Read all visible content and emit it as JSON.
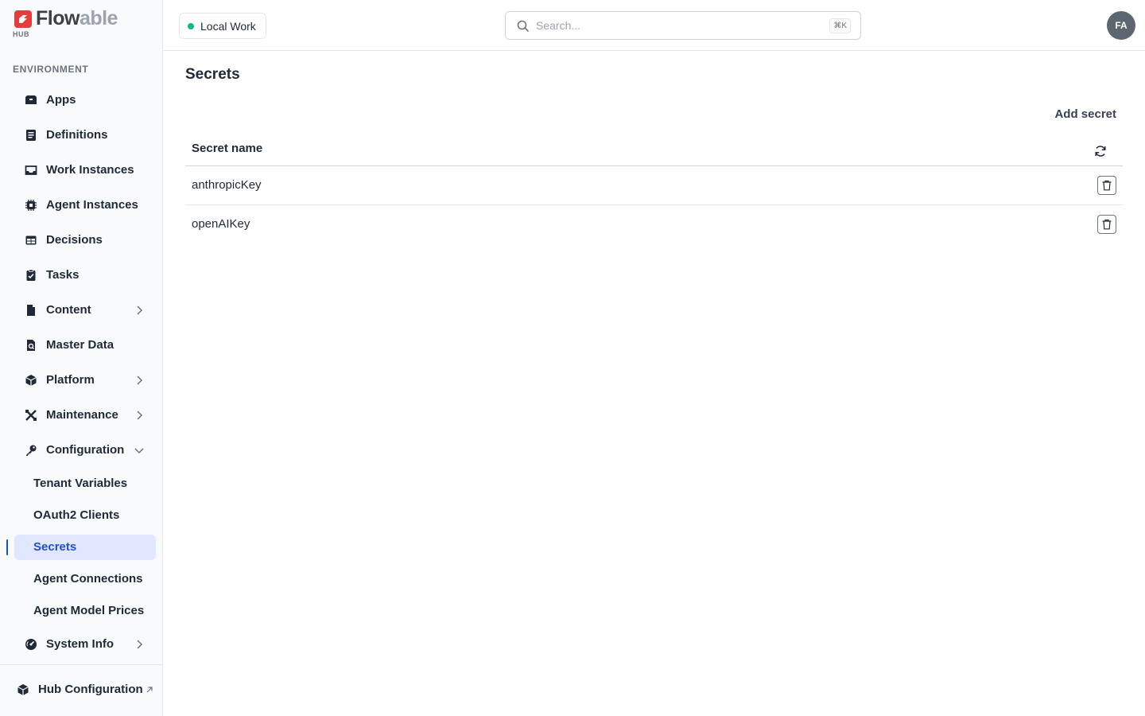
{
  "brand": {
    "name_main": "Flow",
    "name_accent": "able",
    "sub": "HUB",
    "color": "#e63c3c"
  },
  "sidebar": {
    "section_label": "ENVIRONMENT",
    "items": [
      {
        "label": "Apps",
        "icon": "apps-icon"
      },
      {
        "label": "Definitions",
        "icon": "definitions-icon"
      },
      {
        "label": "Work Instances",
        "icon": "inbox-icon"
      },
      {
        "label": "Agent Instances",
        "icon": "chip-icon"
      },
      {
        "label": "Decisions",
        "icon": "table-icon"
      },
      {
        "label": "Tasks",
        "icon": "clipboard-check-icon"
      },
      {
        "label": "Content",
        "icon": "document-icon",
        "expandable": true
      },
      {
        "label": "Master Data",
        "icon": "master-data-icon"
      },
      {
        "label": "Platform",
        "icon": "cube-icon",
        "expandable": true
      },
      {
        "label": "Maintenance",
        "icon": "tools-icon",
        "expandable": true
      },
      {
        "label": "Configuration",
        "icon": "key-icon",
        "expanded": true
      },
      {
        "label": "System Info",
        "icon": "gauge-icon",
        "expandable": true
      }
    ],
    "config_children": [
      {
        "label": "Tenant Variables"
      },
      {
        "label": "OAuth2 Clients"
      },
      {
        "label": "Secrets",
        "active": true
      },
      {
        "label": "Agent Connections"
      },
      {
        "label": "Agent Model Prices"
      }
    ],
    "footer": {
      "label": "Hub Configuration"
    }
  },
  "header": {
    "workspace": "Local Work",
    "workspace_status_color": "#10b981",
    "search_placeholder": "Search...",
    "search_shortcut": "⌘K",
    "avatar_initials": "FA"
  },
  "main": {
    "title": "Secrets",
    "add_button": "Add secret",
    "table": {
      "column": "Secret name",
      "rows": [
        {
          "name": "anthropicKey"
        },
        {
          "name": "openAIKey"
        }
      ]
    }
  },
  "colors": {
    "accent": "#1d4ed8",
    "active_bg": "#e0e7ff"
  }
}
